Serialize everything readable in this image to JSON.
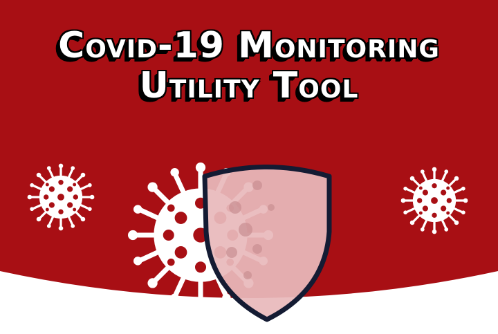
{
  "title": {
    "line1": "Covid-19 Monitoring",
    "line2": "Utility Tool"
  },
  "colors": {
    "background_red": "#a80f14",
    "virus_white": "#ffffff",
    "shield_fill": "#e8b9bb",
    "shield_outline": "#141b33"
  },
  "icons": [
    "virus-icon",
    "shield-icon"
  ]
}
